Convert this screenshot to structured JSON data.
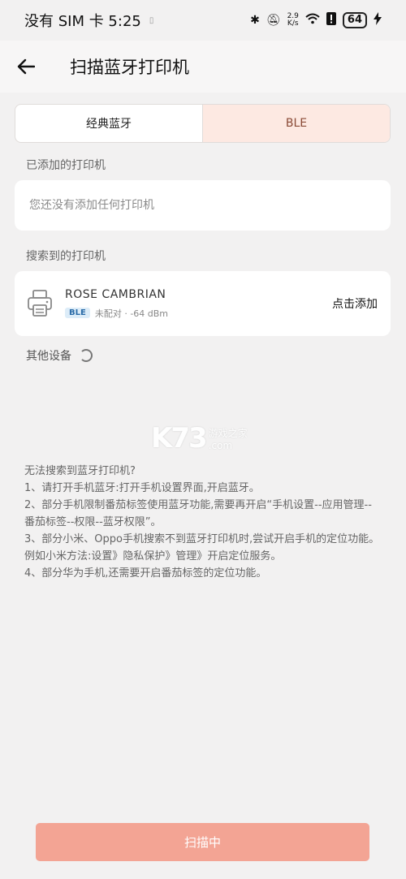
{
  "status_bar": {
    "carrier_time": "没有 SIM 卡 5:25",
    "net_speed_value": "2.9",
    "net_speed_unit": "K/s",
    "battery": "64"
  },
  "header": {
    "title": "扫描蓝牙打印机"
  },
  "tabs": [
    {
      "label": "经典蓝牙",
      "active": false
    },
    {
      "label": "BLE",
      "active": true
    }
  ],
  "added_section": {
    "label": "已添加的打印机",
    "empty_text": "您还没有添加任何打印机"
  },
  "found_section": {
    "label": "搜索到的打印机",
    "printers": [
      {
        "name": "ROSE CAMBRIAN",
        "badge": "BLE",
        "status": "未配对 · -64 dBm",
        "action": "点击添加"
      }
    ]
  },
  "other_devices_label": "其他设备",
  "watermark": {
    "big": "K73",
    "small_top": "游戏之家",
    "small_bottom": ".com"
  },
  "help": {
    "title": "无法搜索到蓝牙打印机?",
    "items": [
      "1、请打开手机蓝牙:打开手机设置界面,开启蓝牙。",
      "2、部分手机限制番茄标签使用蓝牙功能,需要再开启“手机设置--应用管理--番茄标签--权限--蓝牙权限”。",
      "3、部分小米、Oppo手机搜索不到蓝牙打印机时,尝试开启手机的定位功能。例如小米方法:设置》隐私保护》管理》开启定位服务。",
      "4、部分华为手机,还需要开启番茄标签的定位功能。"
    ]
  },
  "scan_button": "扫描中",
  "colors": {
    "accent": "#f3a494",
    "active_tab_bg": "#fde9e2",
    "badge_bg": "#dcecf8"
  }
}
